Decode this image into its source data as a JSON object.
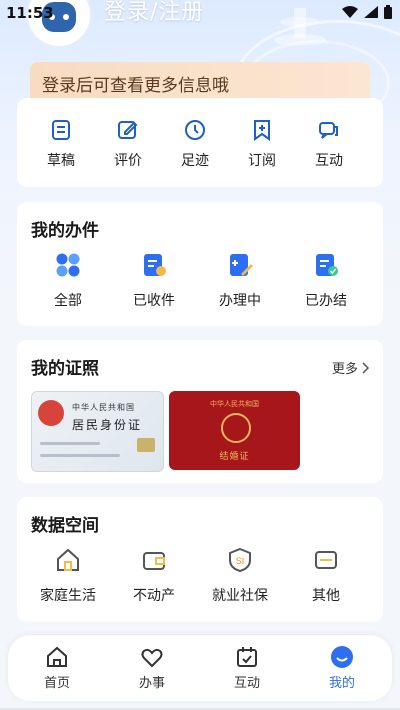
{
  "status_bar": {
    "time": "11:53"
  },
  "header": {
    "title": "登录/注册"
  },
  "banner": {
    "text": "登录后可查看更多信息哦"
  },
  "quick_actions": [
    {
      "label": "草稿",
      "icon": "draft-icon"
    },
    {
      "label": "评价",
      "icon": "edit-review-icon"
    },
    {
      "label": "足迹",
      "icon": "clock-icon"
    },
    {
      "label": "订阅",
      "icon": "bookmark-plus-icon"
    },
    {
      "label": "互动",
      "icon": "chat-icon"
    }
  ],
  "my_work": {
    "title": "我的办件",
    "items": [
      {
        "label": "全部",
        "icon": "grid-four-icon"
      },
      {
        "label": "已收件",
        "icon": "received-doc-icon"
      },
      {
        "label": "办理中",
        "icon": "processing-doc-icon"
      },
      {
        "label": "已办结",
        "icon": "completed-doc-icon"
      }
    ]
  },
  "my_certificates": {
    "title": "我的证照",
    "more": "更多",
    "id_card": {
      "country": "中华人民共和国",
      "name": "居民身份证"
    },
    "marriage_card": {
      "country": "中华人民共和国",
      "name": "结婚证"
    }
  },
  "data_space": {
    "title": "数据空间",
    "items": [
      {
        "label": "家庭生活",
        "icon": "house-icon"
      },
      {
        "label": "不动产",
        "icon": "wallet-icon"
      },
      {
        "label": "就业社保",
        "icon": "shield-si-icon"
      },
      {
        "label": "其他",
        "icon": "box-icon"
      }
    ]
  },
  "bottom_nav": {
    "items": [
      {
        "label": "首页",
        "icon": "home-icon"
      },
      {
        "label": "办事",
        "icon": "heart-icon"
      },
      {
        "label": "互动",
        "icon": "calendar-check-icon"
      },
      {
        "label": "我的",
        "icon": "smile-icon"
      }
    ],
    "active_index": 3
  },
  "colors": {
    "accent": "#2d6ef2",
    "icon_blue": "#1f5fc9"
  }
}
